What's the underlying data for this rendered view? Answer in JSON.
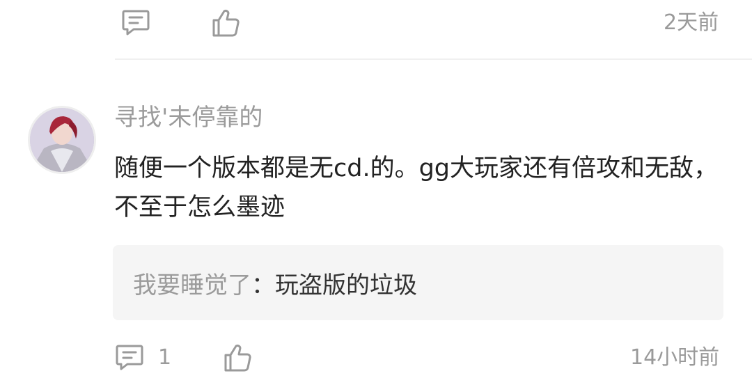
{
  "previous_comment": {
    "time": "2天前"
  },
  "comment": {
    "username": "寻找'未停靠的",
    "text": "随便一个版本都是无cd.的。gg大玩家还有倍攻和无敌，不至于怎么墨迹",
    "reply": {
      "user": "我要睡觉了",
      "separator": "：",
      "content": "玩盗版的垃圾"
    },
    "reply_count": "1",
    "time": "14小时前"
  },
  "icons": {
    "comment": "comment-bubble-icon",
    "like": "thumbs-up-icon",
    "avatar": "user-avatar"
  },
  "colors": {
    "meta_text": "#9a9a9a",
    "body_text": "#222222",
    "reply_bg": "#f5f5f5",
    "divider": "#f0f0f0"
  }
}
